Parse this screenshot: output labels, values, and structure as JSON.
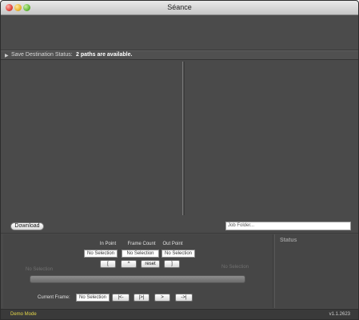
{
  "window": {
    "title": "Séance"
  },
  "status_strip": {
    "label": "Save Destination Status:",
    "value": "2 paths are available."
  },
  "download": {
    "label": "Download"
  },
  "folder_field": {
    "placeholder": "Job Folder..."
  },
  "side_panel": {
    "title": "Status"
  },
  "columns": {
    "in_point": "In Point",
    "frame_count": "Frame Count",
    "out_point": "Out Point"
  },
  "fields": {
    "in_point": "No Selection",
    "frame_count": "No Selection",
    "out_point": "No Selection"
  },
  "mark_buttons": {
    "set_in": "[",
    "up": "^",
    "reset": "reset",
    "set_out": "]"
  },
  "slider": {
    "left_label": "No Selection",
    "right_label": "No Selection"
  },
  "current_frame": {
    "label": "Current Frame:",
    "value": "No Selection"
  },
  "transport": {
    "first": "|<-",
    "step": "|>|",
    "play": ">",
    "last": "->|"
  },
  "footer": {
    "mode": "Demo Mode",
    "version": "v1.1.2623"
  }
}
